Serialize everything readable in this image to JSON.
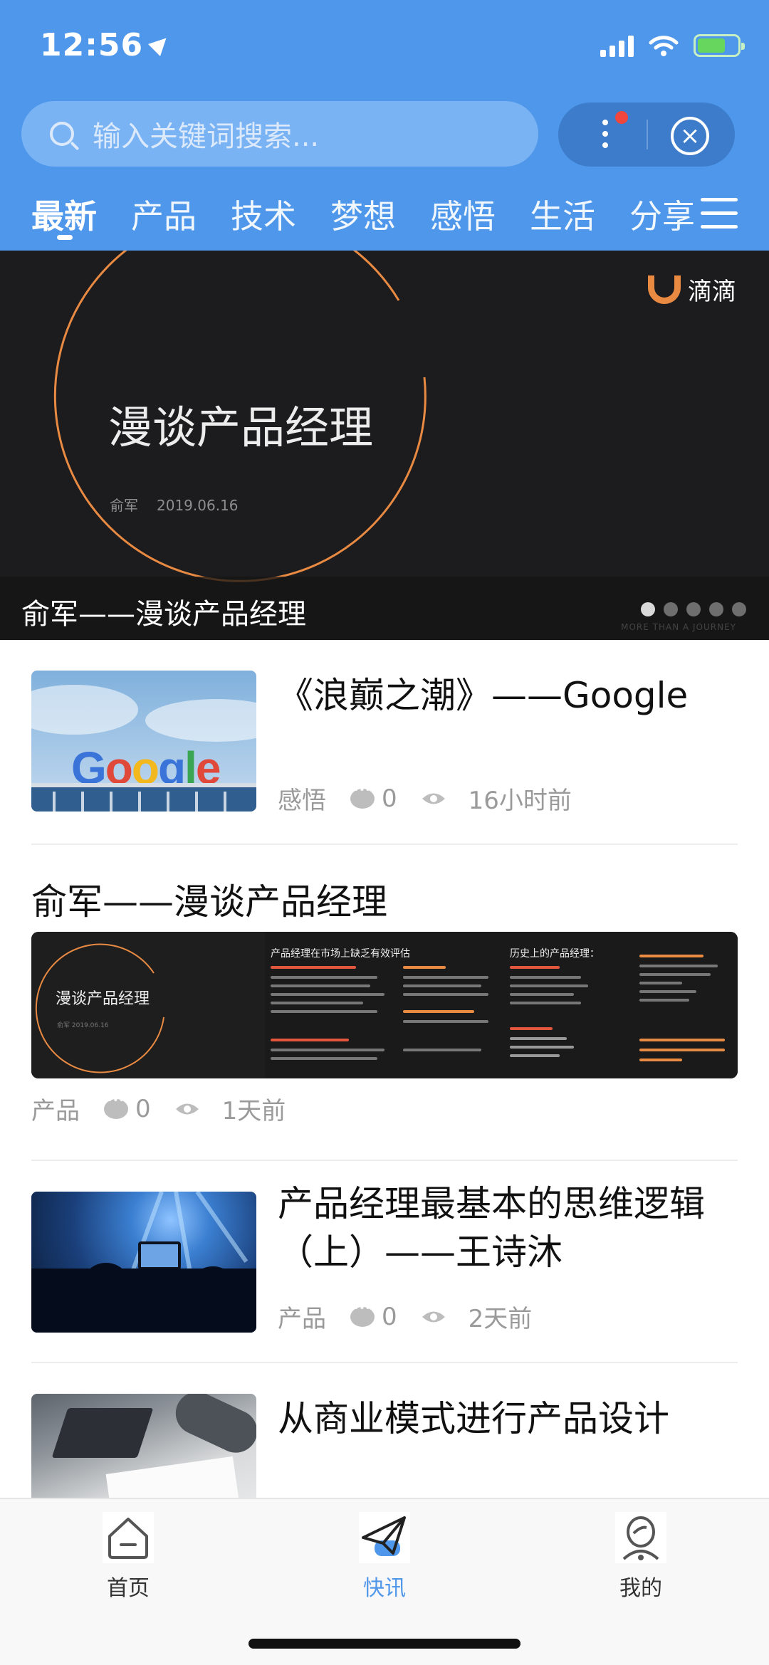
{
  "status_bar": {
    "time": "12:56"
  },
  "search": {
    "placeholder": "输入关键词搜索..."
  },
  "tabs": [
    {
      "label": "最新",
      "active": true
    },
    {
      "label": "产品"
    },
    {
      "label": "技术"
    },
    {
      "label": "梦想"
    },
    {
      "label": "感悟"
    },
    {
      "label": "生活"
    },
    {
      "label": "分享"
    }
  ],
  "banner": {
    "brand": "滴滴",
    "slide_title": "漫谈产品经理",
    "slide_author": "俞军",
    "slide_date": "2019.06.16",
    "caption": "俞军——漫谈产品经理",
    "watermark": "MORE THAN A JOURNEY",
    "dot_count": 5,
    "active_dot": 1
  },
  "feed": [
    {
      "title": "《浪巅之潮》——Google",
      "thumb_logo": "Google",
      "category": "感悟",
      "comments": "0",
      "time": "16小时前"
    },
    {
      "title": "俞军——漫谈产品经理",
      "slides": {
        "pane1_title": "漫谈产品经理",
        "pane1_sub": "俞军   2019.06.16",
        "pane2_head": "产品经理在市场上缺乏有效评估",
        "pane3_head": "历史上的产品经理："
      },
      "category": "产品",
      "comments": "0",
      "time": "1天前"
    },
    {
      "title": "产品经理最基本的思维逻辑（上）——王诗沐",
      "category": "产品",
      "comments": "0",
      "time": "2天前"
    },
    {
      "title": "从商业模式进行产品设计"
    }
  ],
  "tabbar": [
    {
      "label": "首页",
      "icon": "home-icon"
    },
    {
      "label": "快讯",
      "icon": "paper-plane-icon",
      "active": true
    },
    {
      "label": "我的",
      "icon": "profile-icon"
    }
  ],
  "colors": {
    "accent": "#4f97ea",
    "banner_bg": "#1c1c1e",
    "ring": "#e98a43"
  }
}
